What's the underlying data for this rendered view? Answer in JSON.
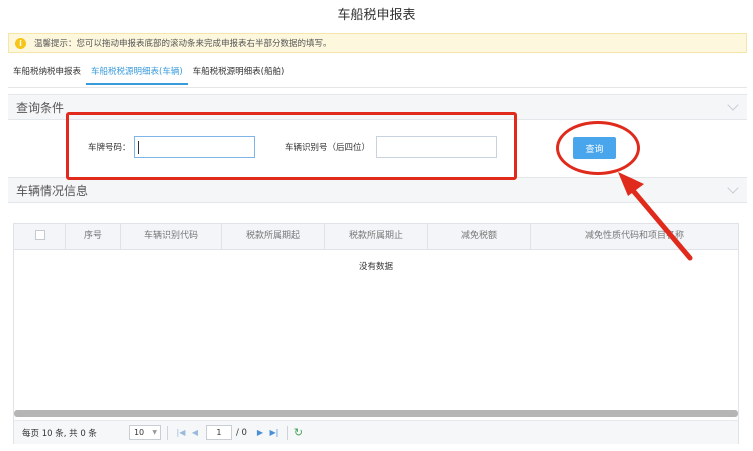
{
  "page_title": "车船税申报表",
  "notice": {
    "icon": "info-icon",
    "text": "温馨提示：您可以拖动申报表底部的滚动条来完成申报表右半部分数据的填写。"
  },
  "tabs": [
    {
      "label": "车船税纳税申报表",
      "active": false
    },
    {
      "label": "车船税税源明细表(车辆)",
      "active": true
    },
    {
      "label": "车船税税源明细表(船舶)",
      "active": false
    }
  ],
  "query_panel": {
    "title": "查询条件",
    "plate_label": "车牌号码：",
    "plate_value": "",
    "vin_label": "车辆识别号（后四位）",
    "vin_value": "",
    "query_button": "查询"
  },
  "vehicle_panel": {
    "title": "车辆情况信息"
  },
  "grid": {
    "columns": [
      "序号",
      "车辆识别代码",
      "税款所属期起",
      "税款所属期止",
      "减免税额",
      "减免性质代码和项目名称"
    ],
    "empty_text": "没有数据"
  },
  "pager": {
    "summary": "每页 10 条, 共 0 条",
    "page_size": "10",
    "current_page": "1",
    "total_pages": "/ 0"
  },
  "colors": {
    "accent": "#4aa6ec",
    "annotation": "#e02a1b",
    "notice_bg": "#fdf8dd"
  }
}
